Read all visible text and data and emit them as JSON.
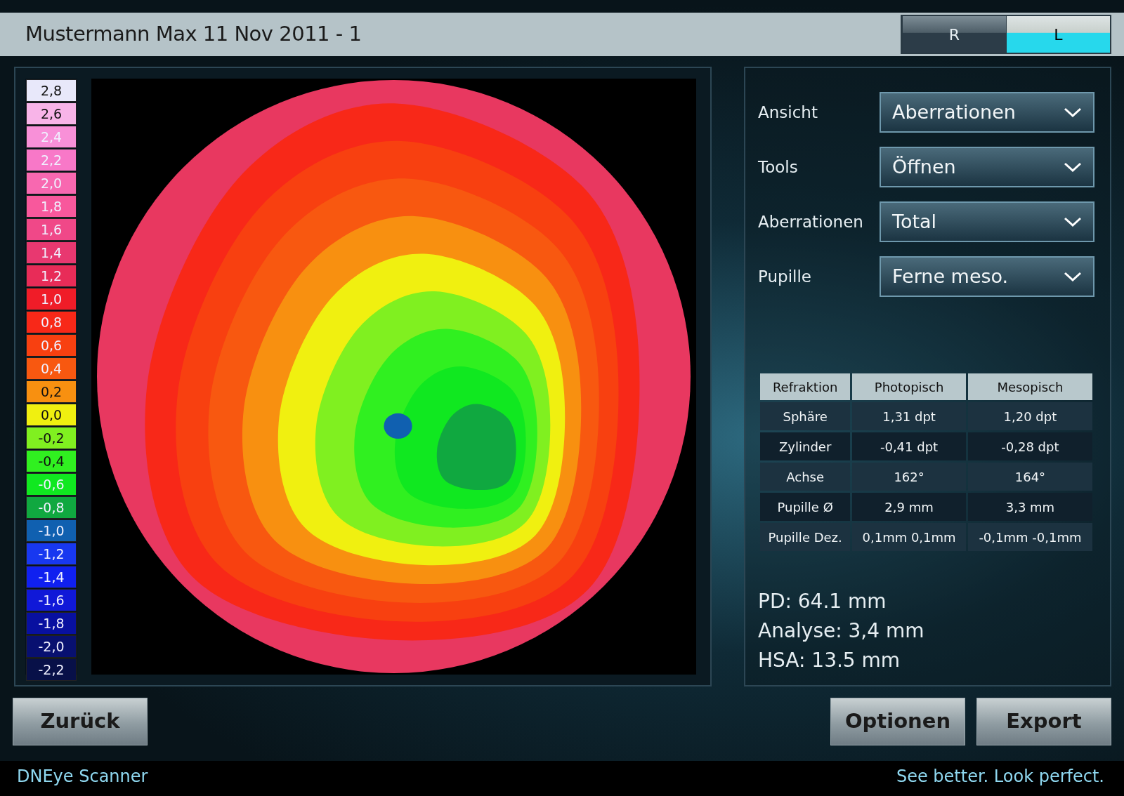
{
  "header": {
    "title": "Mustermann Max 11 Nov 2011 - 1",
    "eyes": [
      {
        "label": "R",
        "selected": false
      },
      {
        "label": "L",
        "selected": true
      }
    ]
  },
  "legend": [
    {
      "label": "2,8",
      "color": "#e8e8fa"
    },
    {
      "label": "2,6",
      "color": "#f8b4e8"
    },
    {
      "label": "2,4",
      "color": "#f890d8"
    },
    {
      "label": "2,2",
      "color": "#f878c8"
    },
    {
      "label": "2,0",
      "color": "#f868b0"
    },
    {
      "label": "1,8",
      "color": "#f8589c"
    },
    {
      "label": "1,6",
      "color": "#f04888"
    },
    {
      "label": "1,4",
      "color": "#e83870"
    },
    {
      "label": "1,2",
      "color": "#e82c58"
    },
    {
      "label": "1,0",
      "color": "#f01c28"
    },
    {
      "label": "0,8",
      "color": "#f82818"
    },
    {
      "label": "0,6",
      "color": "#f84010"
    },
    {
      "label": "0,4",
      "color": "#f85810"
    },
    {
      "label": "0,2",
      "color": "#f89010"
    },
    {
      "label": "0,0",
      "color": "#f0f010"
    },
    {
      "label": "-0,2",
      "color": "#80f020"
    },
    {
      "label": "-0,4",
      "color": "#30f020"
    },
    {
      "label": "-0,6",
      "color": "#10e820"
    },
    {
      "label": "-0,8",
      "color": "#10a840"
    },
    {
      "label": "-1,0",
      "color": "#1060b0"
    },
    {
      "label": "-1,2",
      "color": "#1838f0"
    },
    {
      "label": "-1,4",
      "color": "#1020f0"
    },
    {
      "label": "-1,6",
      "color": "#1018d8"
    },
    {
      "label": "-1,8",
      "color": "#0810a0"
    },
    {
      "label": "-2,0",
      "color": "#081070"
    },
    {
      "label": "-2,2",
      "color": "#081048"
    }
  ],
  "settings": [
    {
      "label": "Ansicht",
      "value": "Aberrationen"
    },
    {
      "label": "Tools",
      "value": "Öffnen"
    },
    {
      "label": "Aberrationen",
      "value": "Total"
    },
    {
      "label": "Pupille",
      "value": "Ferne meso."
    }
  ],
  "table": {
    "columns": [
      "Refraktion",
      "Photopisch",
      "Mesopisch"
    ],
    "rows": [
      [
        "Sphäre",
        "1,31 dpt",
        "1,20 dpt"
      ],
      [
        "Zylinder",
        "-0,41 dpt",
        "-0,28 dpt"
      ],
      [
        "Achse",
        "162°",
        "164°"
      ],
      [
        "Pupille Ø",
        "2,9 mm",
        "3,3 mm"
      ],
      [
        "Pupille Dez.",
        "0,1mm 0,1mm",
        "-0,1mm -0,1mm"
      ]
    ]
  },
  "summary": [
    "PD: 64.1 mm",
    "Analyse: 3,4 mm",
    "HSA: 13.5 mm"
  ],
  "buttons_left": [
    "Zurück"
  ],
  "buttons_right": [
    "Optionen",
    "Export"
  ],
  "footer": {
    "product": "DNEye Scanner",
    "slogan": "See better. Look perfect."
  }
}
